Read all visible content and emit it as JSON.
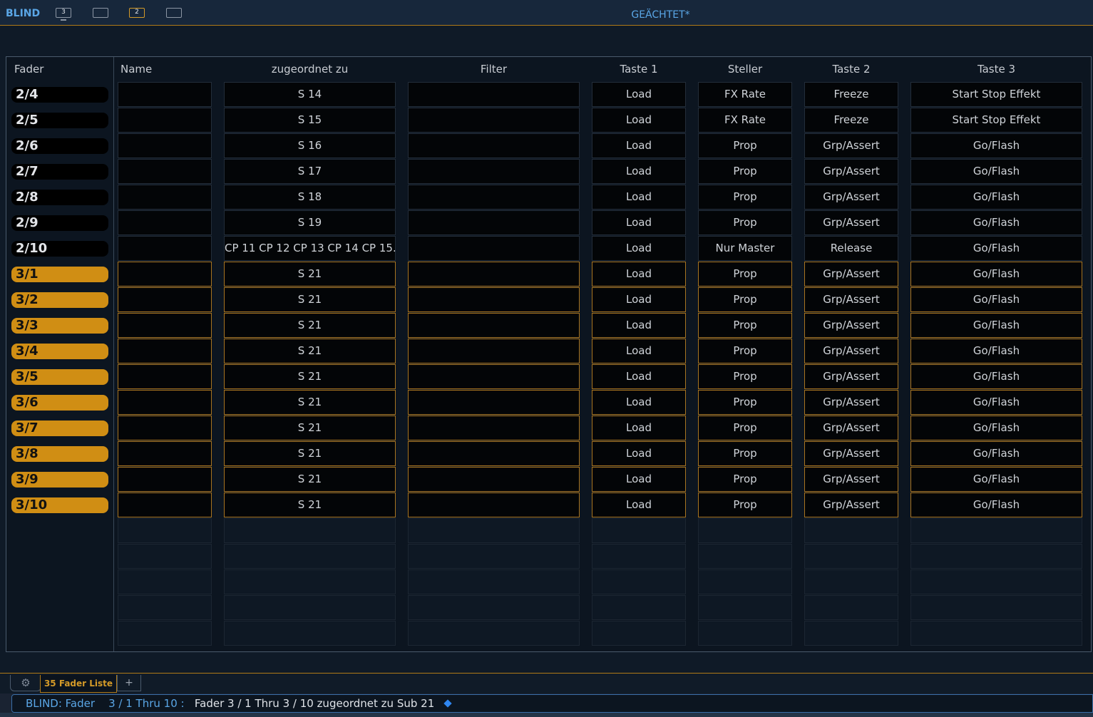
{
  "topbar": {
    "mode": "BLIND",
    "workspaces": [
      "3",
      "",
      "2",
      ""
    ],
    "title": "GEÄCHTET*"
  },
  "table": {
    "headers": {
      "fader": "Fader",
      "name": "Name",
      "assigned": "zugeordnet zu",
      "filter": "Filter",
      "button1": "Taste 1",
      "controller": "Steller",
      "button2": "Taste 2",
      "button3": "Taste 3"
    },
    "rows": [
      {
        "fader": "2/4",
        "name": "",
        "assigned": "S 14",
        "filter": "",
        "button1": "Load",
        "controller": "FX Rate",
        "button2": "Freeze",
        "button3": "Start Stop Effekt",
        "selected": false
      },
      {
        "fader": "2/5",
        "name": "",
        "assigned": "S 15",
        "filter": "",
        "button1": "Load",
        "controller": "FX Rate",
        "button2": "Freeze",
        "button3": "Start Stop Effekt",
        "selected": false
      },
      {
        "fader": "2/6",
        "name": "",
        "assigned": "S 16",
        "filter": "",
        "button1": "Load",
        "controller": "Prop",
        "button2": "Grp/Assert",
        "button3": "Go/Flash",
        "selected": false
      },
      {
        "fader": "2/7",
        "name": "",
        "assigned": "S 17",
        "filter": "",
        "button1": "Load",
        "controller": "Prop",
        "button2": "Grp/Assert",
        "button3": "Go/Flash",
        "selected": false
      },
      {
        "fader": "2/8",
        "name": "",
        "assigned": "S 18",
        "filter": "",
        "button1": "Load",
        "controller": "Prop",
        "button2": "Grp/Assert",
        "button3": "Go/Flash",
        "selected": false
      },
      {
        "fader": "2/9",
        "name": "",
        "assigned": "S 19",
        "filter": "",
        "button1": "Load",
        "controller": "Prop",
        "button2": "Grp/Assert",
        "button3": "Go/Flash",
        "selected": false
      },
      {
        "fader": "2/10",
        "name": "",
        "assigned": "CP 11 CP 12 CP 13 CP 14 CP 15...",
        "filter": "",
        "button1": "Load",
        "controller": "Nur Master",
        "button2": "Release",
        "button3": "Go/Flash",
        "selected": false
      },
      {
        "fader": "3/1",
        "name": "",
        "assigned": "S 21",
        "filter": "",
        "button1": "Load",
        "controller": "Prop",
        "button2": "Grp/Assert",
        "button3": "Go/Flash",
        "selected": true
      },
      {
        "fader": "3/2",
        "name": "",
        "assigned": "S 21",
        "filter": "",
        "button1": "Load",
        "controller": "Prop",
        "button2": "Grp/Assert",
        "button3": "Go/Flash",
        "selected": true
      },
      {
        "fader": "3/3",
        "name": "",
        "assigned": "S 21",
        "filter": "",
        "button1": "Load",
        "controller": "Prop",
        "button2": "Grp/Assert",
        "button3": "Go/Flash",
        "selected": true
      },
      {
        "fader": "3/4",
        "name": "",
        "assigned": "S 21",
        "filter": "",
        "button1": "Load",
        "controller": "Prop",
        "button2": "Grp/Assert",
        "button3": "Go/Flash",
        "selected": true
      },
      {
        "fader": "3/5",
        "name": "",
        "assigned": "S 21",
        "filter": "",
        "button1": "Load",
        "controller": "Prop",
        "button2": "Grp/Assert",
        "button3": "Go/Flash",
        "selected": true
      },
      {
        "fader": "3/6",
        "name": "",
        "assigned": "S 21",
        "filter": "",
        "button1": "Load",
        "controller": "Prop",
        "button2": "Grp/Assert",
        "button3": "Go/Flash",
        "selected": true
      },
      {
        "fader": "3/7",
        "name": "",
        "assigned": "S 21",
        "filter": "",
        "button1": "Load",
        "controller": "Prop",
        "button2": "Grp/Assert",
        "button3": "Go/Flash",
        "selected": true
      },
      {
        "fader": "3/8",
        "name": "",
        "assigned": "S 21",
        "filter": "",
        "button1": "Load",
        "controller": "Prop",
        "button2": "Grp/Assert",
        "button3": "Go/Flash",
        "selected": true
      },
      {
        "fader": "3/9",
        "name": "",
        "assigned": "S 21",
        "filter": "",
        "button1": "Load",
        "controller": "Prop",
        "button2": "Grp/Assert",
        "button3": "Go/Flash",
        "selected": true
      },
      {
        "fader": "3/10",
        "name": "",
        "assigned": "S 21",
        "filter": "",
        "button1": "Load",
        "controller": "Prop",
        "button2": "Grp/Assert",
        "button3": "Go/Flash",
        "selected": true
      }
    ]
  },
  "tabs": {
    "settings_icon": "gear-icon",
    "active_tab": "35 Fader Liste",
    "add_label": "+"
  },
  "command_line": {
    "prefix": "BLIND: Fader",
    "range": "3 / 1 Thru 10 :",
    "text": "Fader  3 / 1 Thru 3 / 10 zugeordnet zu Sub 21"
  },
  "colors": {
    "accent": "#d08e14",
    "mode_blue": "#5aa6e6",
    "background": "#0c1520"
  }
}
